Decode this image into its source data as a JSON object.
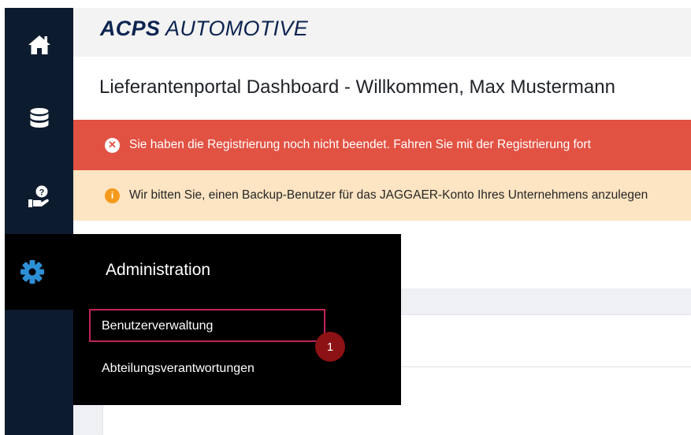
{
  "brand": {
    "bold": "ACPS",
    "light": "AUTOMOTIVE"
  },
  "sidebar": {
    "items": [
      {
        "icon": "home-icon"
      },
      {
        "icon": "database-icon"
      },
      {
        "icon": "hand-help-icon"
      },
      {
        "icon": "gear-icon"
      }
    ]
  },
  "header": {
    "title": "Lieferantenportal Dashboard - Willkommen, Max Mustermann"
  },
  "alerts": {
    "danger": {
      "icon": "x-circle-icon",
      "text": "Sie haben die Registrierung noch nicht beendet. Fahren Sie mit der Registrierung fort"
    },
    "warning": {
      "icon": "info-circle-icon",
      "text": "Wir bitten Sie, einen Backup-Benutzer für das JAGGAER-Konto Ihres Unternehmens anzulegen"
    }
  },
  "flyout": {
    "title": "Administration",
    "items": [
      {
        "label": "Benutzerverwaltung"
      },
      {
        "label": "Abteilungsverantwortungen"
      }
    ]
  },
  "annotation": {
    "step": "1"
  },
  "colors": {
    "sidebar": "#0d1b2e",
    "brand": "#0d2450",
    "danger": "#e25243",
    "warning": "#fde4c2",
    "gear": "#2d8fd6",
    "highlight": "#c0245c",
    "badge": "#8d1215"
  }
}
